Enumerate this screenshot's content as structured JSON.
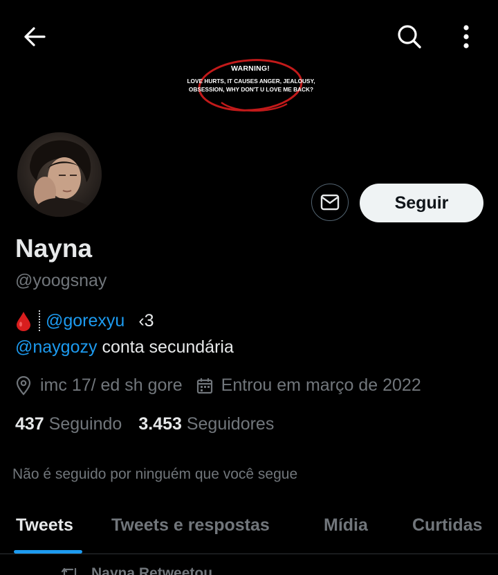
{
  "header": {
    "back_icon": "arrow-left-icon",
    "search_icon": "search-icon",
    "more_icon": "more-vertical-icon"
  },
  "banner": {
    "warning": "WARNING!",
    "line1": "LOVE HURTS, IT CAUSES ANGER, JEALOUSY,",
    "line2": "OBSESSION, WHY DON'T U LOVE ME BACK?",
    "accent": "#c21a1a"
  },
  "profile": {
    "display_name": "Nayna",
    "handle": "@yoogsnay",
    "message_icon": "envelope-icon",
    "follow_label": "Seguir"
  },
  "bio": {
    "drop_icon": "blood-drop-icon",
    "mention1": "@gorexyu",
    "heart": "‹3",
    "mention2": "@naygozy",
    "line2_text": " conta secundária"
  },
  "meta": {
    "location_icon": "location-pin-icon",
    "location": "imc 17/ ed sh gore",
    "calendar_icon": "calendar-icon",
    "joined": "Entrou em março de 2022"
  },
  "stats": {
    "following_count": "437",
    "following_label": "Seguindo",
    "followers_count": "3.453",
    "followers_label": "Seguidores"
  },
  "followed_by_note": "Não é seguido por ninguém que você segue",
  "tabs": [
    {
      "label": "Tweets",
      "active": true
    },
    {
      "label": "Tweets e respostas",
      "active": false
    },
    {
      "label": "Mídia",
      "active": false
    },
    {
      "label": "Curtidas",
      "active": false
    }
  ],
  "first_tweet": {
    "retweet_icon": "retweet-icon",
    "context": "Nayna Retweetou"
  },
  "colors": {
    "background": "#000000",
    "text_primary": "#e7e9ea",
    "text_secondary": "#71767b",
    "link": "#1d9bf0",
    "tab_indicator": "#1d9bf0"
  }
}
